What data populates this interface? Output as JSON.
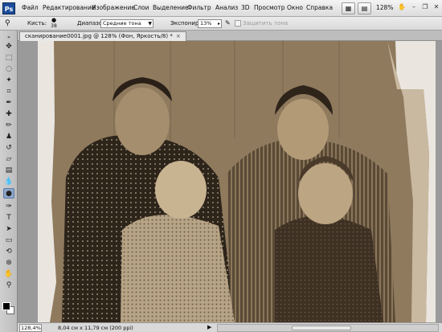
{
  "app": {
    "logo": "Ps",
    "menu": [
      "Файл",
      "Редактирование",
      "Изображение",
      "Слои",
      "Выделение",
      "Фильтр",
      "Анализ",
      "3D",
      "Просмотр",
      "Окно",
      "Справка"
    ],
    "zoom": "128%"
  },
  "options": {
    "brush_label": "Кисть:",
    "brush_size": "38",
    "range_label": "Диапазон:",
    "range_value": "Средние тона",
    "exposure_label": "Экспонир.:",
    "exposure_value": "13%",
    "protect_label": "Защитить тона"
  },
  "document": {
    "tab_title": "сканирование0001.jpg @ 128% (Фон, Яркость/8) *",
    "close": "×"
  },
  "status": {
    "zoom": "128,4%",
    "info": "8,04 см x 11,79 см (200 ppi)",
    "arrow": "▶"
  },
  "colors": {
    "foreground": "#000000",
    "background": "#ffffff",
    "accent": "#1d4d9a"
  }
}
